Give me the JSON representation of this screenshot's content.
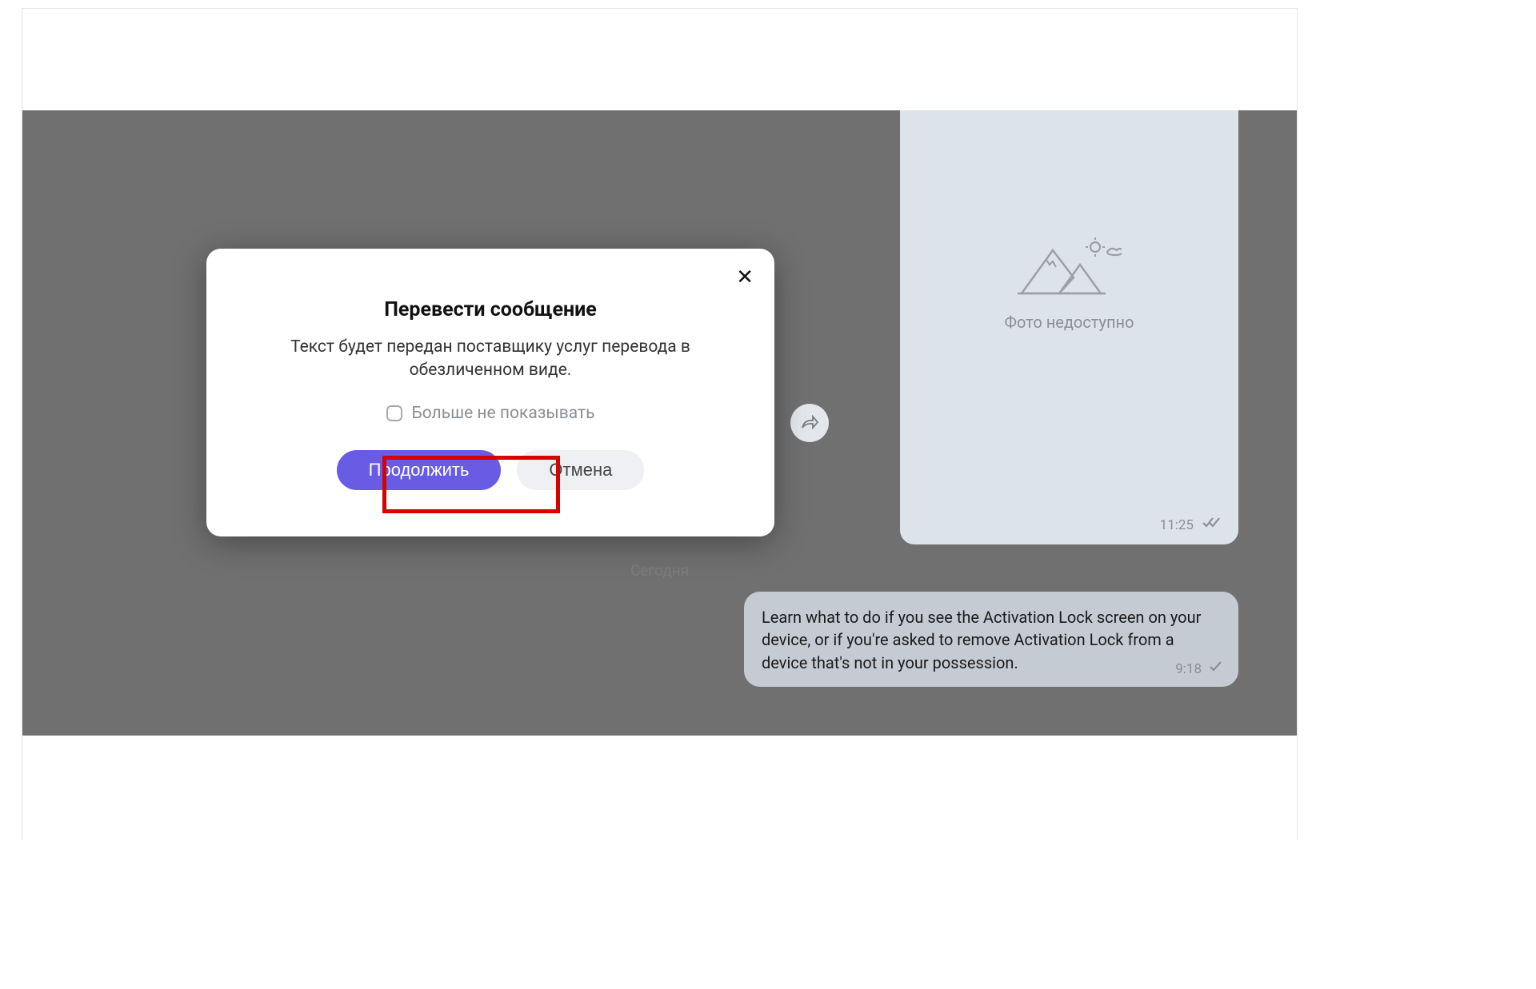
{
  "modal": {
    "title": "Перевести сообщение",
    "body": "Текст будет передан поставщику услуг перевода в обезличенном виде.",
    "checkbox_label": "Больше не показывать",
    "continue_label": "Продолжить",
    "cancel_label": "Отмена"
  },
  "chat": {
    "photo_unavailable": "Фото недоступно",
    "photo_time": "11:25",
    "date_separator": "Сегодня",
    "message_text": "Learn what to do if you see the Activation Lock screen on your device, or if you're asked to remove Activation Lock from a device that's not in your possession.",
    "message_time": "9:18"
  }
}
